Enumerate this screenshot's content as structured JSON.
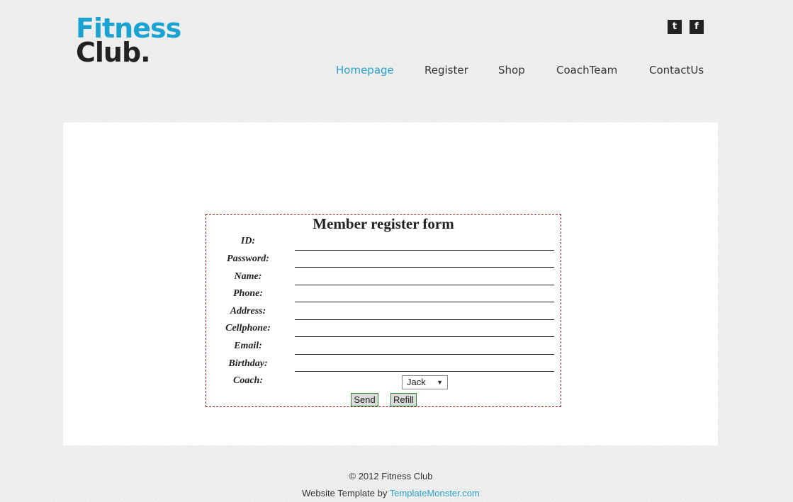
{
  "logo": {
    "line1": "Fitness",
    "line2": "Club.",
    "accent_color": "#1aa3d0"
  },
  "social": {
    "twitter_glyph": "t",
    "facebook_glyph": "f"
  },
  "nav": {
    "items": [
      {
        "label": "Homepage",
        "active": true
      },
      {
        "label": "Register",
        "active": false
      },
      {
        "label": "Shop",
        "active": false
      },
      {
        "label": "CoachTeam",
        "active": false
      },
      {
        "label": "ContactUs",
        "active": false
      }
    ],
    "active_color": "#2aa1c9"
  },
  "form": {
    "title": "Member register form",
    "fields": [
      {
        "label": "ID:",
        "value": ""
      },
      {
        "label": "Password:",
        "value": ""
      },
      {
        "label": "Name:",
        "value": ""
      },
      {
        "label": "Phone:",
        "value": ""
      },
      {
        "label": "Address:",
        "value": ""
      },
      {
        "label": "Cellphone:",
        "value": ""
      },
      {
        "label": "Email:",
        "value": ""
      },
      {
        "label": "Birthday:",
        "value": ""
      }
    ],
    "coach_label": "Coach:",
    "coach_selected": "Jack",
    "send_label": "Send",
    "refill_label": "Refill"
  },
  "footer": {
    "copyright": "© 2012 Fitness Club",
    "template_prefix": "Website Template by ",
    "template_link": "TemplateMonster.com"
  }
}
